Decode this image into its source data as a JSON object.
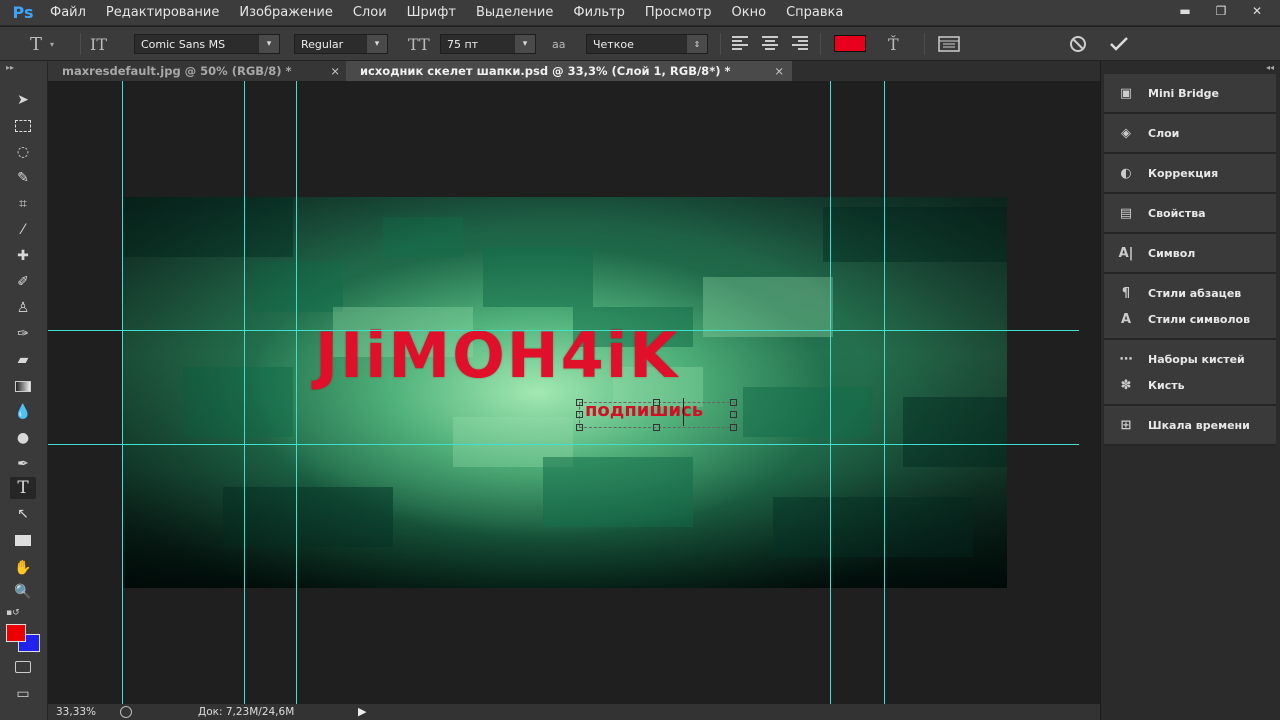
{
  "app": {
    "logo": "Ps"
  },
  "menu": [
    "Файл",
    "Редактирование",
    "Изображение",
    "Слои",
    "Шрифт",
    "Выделение",
    "Фильтр",
    "Просмотр",
    "Окно",
    "Справка"
  ],
  "window_controls": {
    "minimize": "▬",
    "restore": "❐",
    "close": "✕"
  },
  "options": {
    "font_family": "Comic Sans MS",
    "font_style": "Regular",
    "font_size": "75 пт",
    "antialias": "Четкое",
    "aa_label": "аa",
    "text_color": "#e8001c"
  },
  "tabs": [
    {
      "label": "maxresdefault.jpg @ 50% (RGB/8) *",
      "close": "×",
      "active": false
    },
    {
      "label": "исходник скелет шапки.psd @ 33,3% (Слой 1, RGB/8*) *",
      "close": "×",
      "active": true
    }
  ],
  "canvas": {
    "main_text": "JIiMOH4iK",
    "sub_text": "подпишись",
    "guide_color": "#3fe0d0",
    "text_color": "#e0102a"
  },
  "colors": {
    "foreground": "#ee0000",
    "background": "#2222ee"
  },
  "status": {
    "zoom": "33,33%",
    "doc": "Док: 7,23M/24,6M",
    "arrow": "▶"
  },
  "panels": [
    {
      "items": [
        {
          "icon": "mini-bridge-icon",
          "label": "Mini Bridge"
        }
      ]
    },
    {
      "items": [
        {
          "icon": "layers-icon",
          "label": "Слои"
        }
      ]
    },
    {
      "items": [
        {
          "icon": "adjustments-icon",
          "label": "Коррекция"
        }
      ]
    },
    {
      "items": [
        {
          "icon": "properties-icon",
          "label": "Свойства"
        }
      ]
    },
    {
      "items": [
        {
          "icon": "character-icon",
          "label": "Символ"
        }
      ]
    },
    {
      "items": [
        {
          "icon": "paragraph-styles-icon",
          "label": "Стили абзацев"
        },
        {
          "icon": "character-styles-icon",
          "label": "Стили символов"
        }
      ]
    },
    {
      "items": [
        {
          "icon": "brush-presets-icon",
          "label": "Наборы кистей"
        },
        {
          "icon": "brush-icon",
          "label": "Кисть"
        }
      ]
    },
    {
      "items": [
        {
          "icon": "timeline-icon",
          "label": "Шкала времени"
        }
      ]
    }
  ]
}
